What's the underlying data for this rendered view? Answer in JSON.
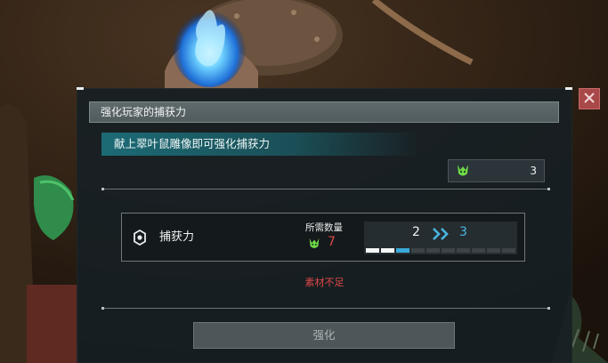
{
  "dialog": {
    "title": "强化玩家的捕获力",
    "description": "献上翠叶鼠雕像即可强化捕获力",
    "owned": {
      "icon": "leaf-mouse-statue-icon",
      "count": "3"
    },
    "stat": {
      "icon": "capture-power-icon",
      "name": "捕获力",
      "required_label": "所需数量",
      "required_icon": "leaf-mouse-statue-icon",
      "required_value": "7",
      "level_from": "2",
      "level_to": "3",
      "level_progress": {
        "filled": 2,
        "next": 1,
        "total": 10
      }
    },
    "warning": "素材不足",
    "enhance_button": "强化",
    "close_icon": "close-icon"
  },
  "colors": {
    "accent_cyan": "#47b6e0",
    "warning_red": "#e04848",
    "close_red": "#a84848",
    "title_bar": "#5f6a6d",
    "desc_band": "#1c7884"
  }
}
